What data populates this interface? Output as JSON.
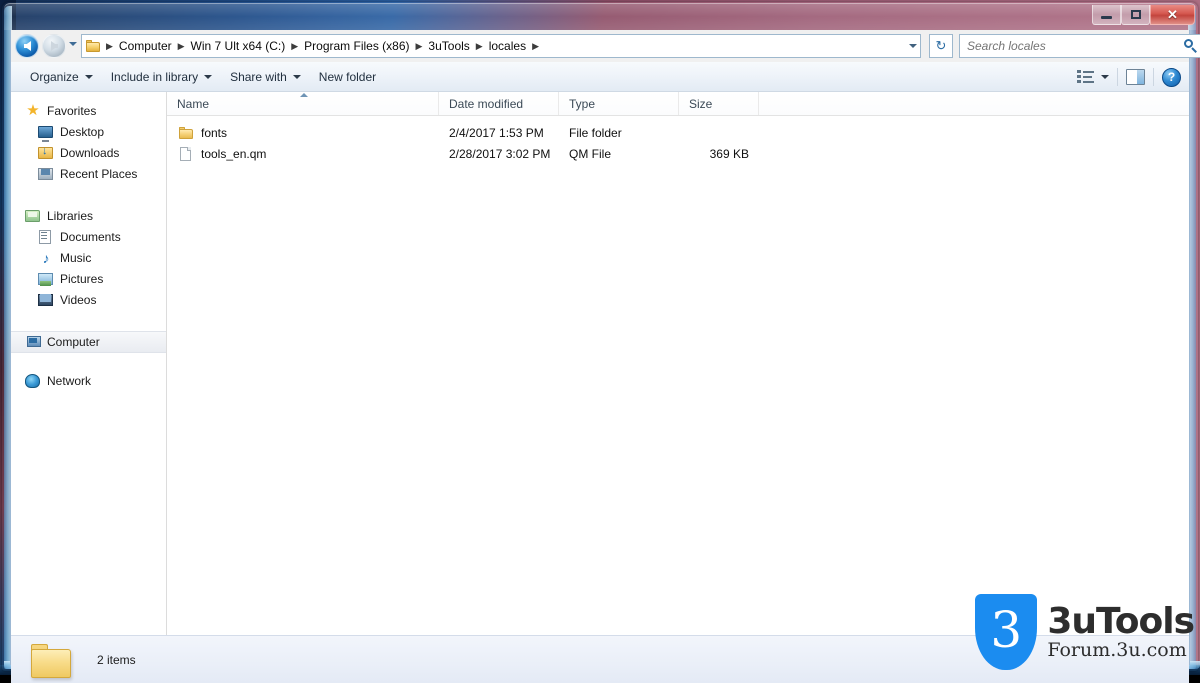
{
  "window": {
    "controls": {
      "minimize_label": "Minimize",
      "maximize_label": "Maximize",
      "close_label": "✕"
    }
  },
  "addressbar": {
    "back_label": "Back",
    "forward_label": "Forward",
    "recent_pages_label": "Recent pages",
    "folder_icon": "folder-icon",
    "breadcrumbs": [
      {
        "label": "Computer"
      },
      {
        "label": "Win 7 Ult x64 (C:)"
      },
      {
        "label": "Program Files (x86)"
      },
      {
        "label": "3uTools"
      },
      {
        "label": "locales"
      }
    ],
    "separator": "▶",
    "dropdown_label": "Previous locations",
    "refresh_icon": "↻",
    "refresh_label": "Refresh"
  },
  "search": {
    "placeholder": "Search locales",
    "value": "",
    "icon": "search-icon"
  },
  "toolbar": {
    "items": [
      {
        "label": "Organize",
        "has_caret": true
      },
      {
        "label": "Include in library",
        "has_caret": true
      },
      {
        "label": "Share with",
        "has_caret": true
      },
      {
        "label": "New folder",
        "has_caret": false
      }
    ],
    "view_label": "Change your view",
    "view_icon": "view-options-icon",
    "preview_label": "Show the preview pane",
    "preview_icon": "preview-pane-icon",
    "help_label": "?",
    "help_icon": "help-icon"
  },
  "navpane": {
    "groups": [
      {
        "header": {
          "label": "Favorites",
          "icon": "star-icon"
        },
        "items": [
          {
            "label": "Desktop",
            "icon": "desktop-icon"
          },
          {
            "label": "Downloads",
            "icon": "downloads-icon"
          },
          {
            "label": "Recent Places",
            "icon": "recent-places-icon"
          }
        ]
      },
      {
        "header": {
          "label": "Libraries",
          "icon": "libraries-icon"
        },
        "items": [
          {
            "label": "Documents",
            "icon": "documents-icon"
          },
          {
            "label": "Music",
            "icon": "music-icon"
          },
          {
            "label": "Pictures",
            "icon": "pictures-icon"
          },
          {
            "label": "Videos",
            "icon": "videos-icon"
          }
        ]
      },
      {
        "header": {
          "label": "Computer",
          "icon": "computer-icon",
          "selected": true
        },
        "items": []
      },
      {
        "header": {
          "label": "Network",
          "icon": "network-icon"
        },
        "items": []
      }
    ]
  },
  "filelist": {
    "columns": [
      {
        "label": "Name",
        "sorted": true,
        "sort_direction": "ascending"
      },
      {
        "label": "Date modified"
      },
      {
        "label": "Type"
      },
      {
        "label": "Size"
      }
    ],
    "rows": [
      {
        "name": "fonts",
        "date_modified": "2/4/2017 1:53 PM",
        "type": "File folder",
        "size": "",
        "icon": "folder-icon"
      },
      {
        "name": "tools_en.qm",
        "date_modified": "2/28/2017 3:02 PM",
        "type": "QM File",
        "size": "369 KB",
        "icon": "file-icon"
      }
    ]
  },
  "statusbar": {
    "item_count_text": "2 items",
    "icon": "folder-large-icon"
  },
  "watermark": {
    "shield_glyph": "3",
    "title": "3uTools",
    "subtitle": "Forum.3u.com",
    "brand_color": "#1b8cf0"
  }
}
